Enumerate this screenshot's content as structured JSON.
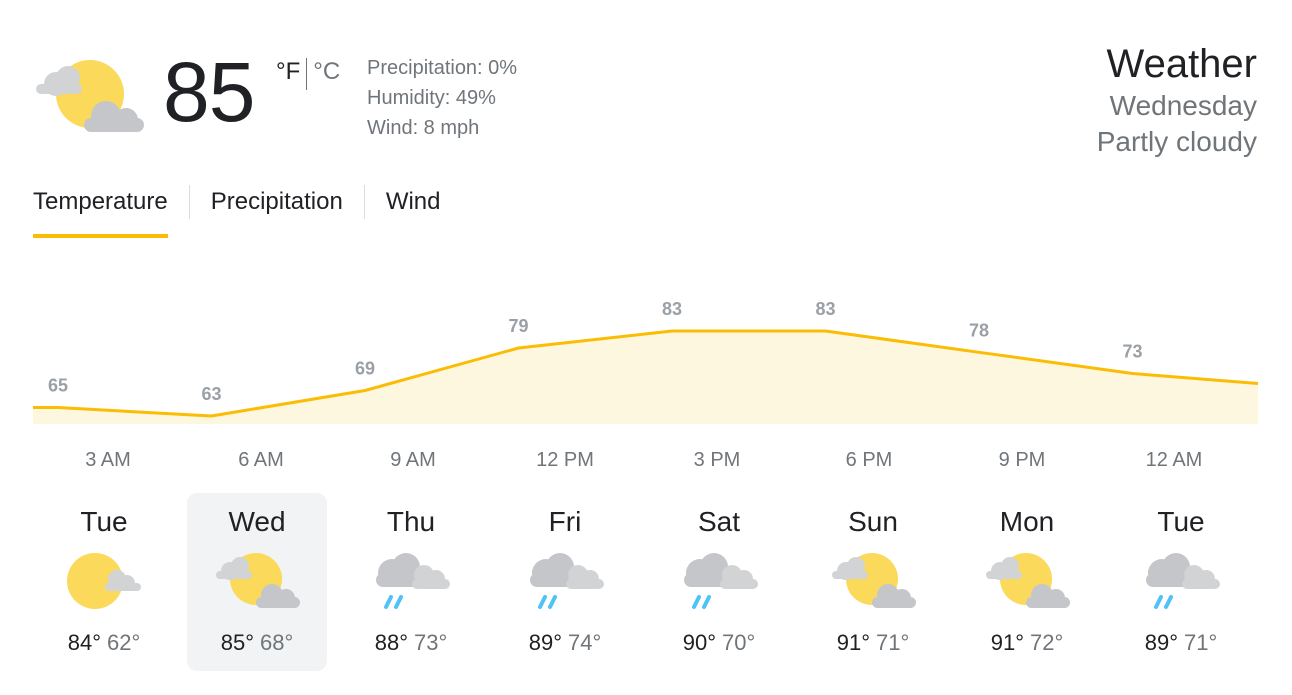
{
  "current": {
    "temperature": "85",
    "unit_f": "°F",
    "unit_c": "°C",
    "icon": "partly-cloudy-icon",
    "precipitation": "Precipitation: 0%",
    "humidity": "Humidity: 49%",
    "wind": "Wind: 8 mph"
  },
  "header": {
    "title": "Weather",
    "day": "Wednesday",
    "condition": "Partly cloudy"
  },
  "tabs": [
    {
      "label": "Temperature",
      "active": true
    },
    {
      "label": "Precipitation",
      "active": false
    },
    {
      "label": "Wind",
      "active": false
    }
  ],
  "colors": {
    "accent": "#fbbc04",
    "fill": "#fef7e0",
    "sun": "#fbd95a",
    "cloud": "#d2d3d5",
    "rain": "#4fc3f7"
  },
  "chart_data": {
    "type": "area",
    "x": [
      "3 AM",
      "6 AM",
      "9 AM",
      "12 PM",
      "3 PM",
      "6 PM",
      "9 PM",
      "12 AM"
    ],
    "values": [
      65,
      63,
      69,
      79,
      83,
      83,
      78,
      73
    ],
    "labels": [
      "65",
      "63",
      "69",
      "79",
      "83",
      "83",
      "78",
      "73"
    ],
    "xlabel": "",
    "ylabel": ""
  },
  "forecast": [
    {
      "day": "Tue",
      "icon": "sun-cloud-icon",
      "hi": "84°",
      "lo": "62°"
    },
    {
      "day": "Wed",
      "icon": "partly-cloudy-icon",
      "hi": "85°",
      "lo": "68°"
    },
    {
      "day": "Thu",
      "icon": "rain-cloud-icon",
      "hi": "88°",
      "lo": "73°"
    },
    {
      "day": "Fri",
      "icon": "rain-cloud-icon",
      "hi": "89°",
      "lo": "74°"
    },
    {
      "day": "Sat",
      "icon": "rain-cloud-icon",
      "hi": "90°",
      "lo": "70°"
    },
    {
      "day": "Sun",
      "icon": "partly-cloudy-icon",
      "hi": "91°",
      "lo": "71°"
    },
    {
      "day": "Mon",
      "icon": "partly-cloudy-icon",
      "hi": "91°",
      "lo": "72°"
    },
    {
      "day": "Tue",
      "icon": "rain-cloud-icon",
      "hi": "89°",
      "lo": "71°"
    }
  ]
}
